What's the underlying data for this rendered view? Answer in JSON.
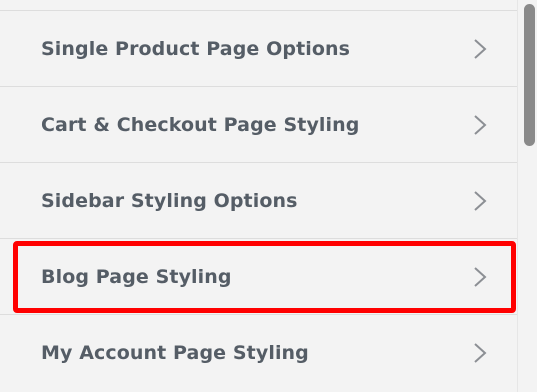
{
  "menu": {
    "items": [
      {
        "label": "Single Product Page Options",
        "icon": "chevron-right-icon"
      },
      {
        "label": "Cart & Checkout Page Styling",
        "icon": "chevron-right-icon"
      },
      {
        "label": "Sidebar Styling Options",
        "icon": "chevron-right-icon"
      },
      {
        "label": "Blog Page Styling",
        "icon": "chevron-right-icon",
        "highlighted": true
      },
      {
        "label": "My Account Page Styling",
        "icon": "chevron-right-icon"
      }
    ]
  },
  "colors": {
    "background": "#f3f3f3",
    "label": "#555d66",
    "chevron": "#8c8f94",
    "highlight": "#ff0000",
    "scrollbar_thumb": "#8a8a8a"
  }
}
